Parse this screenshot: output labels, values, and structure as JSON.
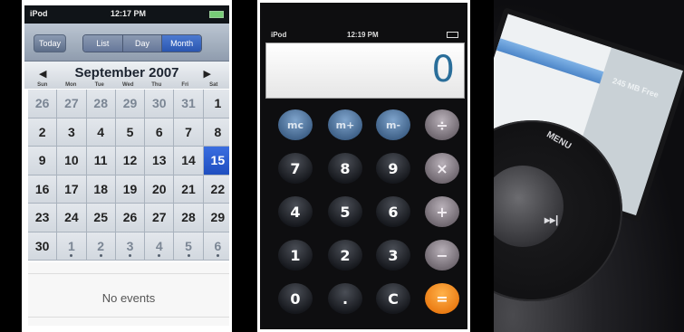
{
  "calendar": {
    "status": {
      "carrier": "iPod",
      "time": "12:17 PM"
    },
    "toolbar": {
      "today": "Today",
      "views": [
        "List",
        "Day",
        "Month"
      ]
    },
    "month_title": "September 2007",
    "prev_arrow": "◀",
    "next_arrow": "▶",
    "weekdays": [
      "Sun",
      "Mon",
      "Tue",
      "Wed",
      "Thu",
      "Fri",
      "Sat"
    ],
    "days": [
      "26",
      "27",
      "28",
      "29",
      "30",
      "31",
      "1",
      "2",
      "3",
      "4",
      "5",
      "6",
      "7",
      "8",
      "9",
      "10",
      "11",
      "12",
      "13",
      "14",
      "15",
      "16",
      "17",
      "18",
      "19",
      "20",
      "21",
      "22",
      "23",
      "24",
      "25",
      "26",
      "27",
      "28",
      "29",
      "30",
      "1",
      "2",
      "3",
      "4",
      "5",
      "6"
    ],
    "selected_day": "15",
    "no_events": "No events"
  },
  "calculator": {
    "status": {
      "carrier": "iPod",
      "time": "12:19 PM"
    },
    "display": "0",
    "keys": {
      "row1": [
        "mc",
        "m+",
        "m-",
        "÷"
      ],
      "row2": [
        "7",
        "8",
        "9",
        "×"
      ],
      "row3": [
        "4",
        "5",
        "6",
        "+"
      ],
      "row4": [
        "1",
        "2",
        "3",
        "−"
      ],
      "row5": [
        "0",
        ".",
        "C",
        "="
      ]
    }
  },
  "ipod": {
    "free_space": "245 MB Free",
    "menu_label": "MENU",
    "ff_label": "▸▸|"
  }
}
